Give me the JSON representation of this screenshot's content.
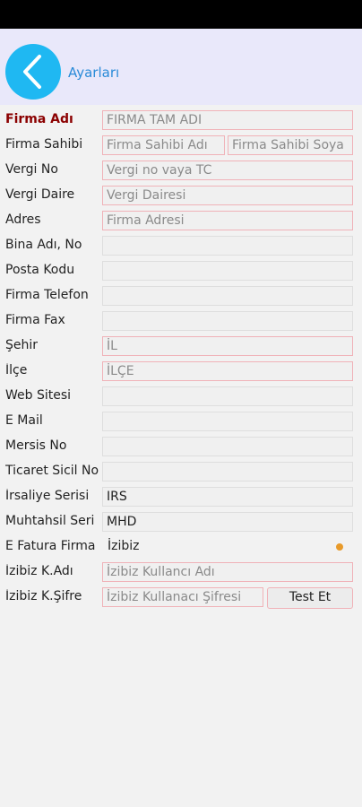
{
  "header": {
    "title": "Ayarları"
  },
  "rows": {
    "firma_adi": {
      "label": "Firma Adı",
      "placeholder": "FIRMA TAM ADI"
    },
    "firma_sahibi": {
      "label": "Firma Sahibi",
      "placeholder1": "Firma Sahibi Adı",
      "placeholder2": "Firma Sahibi Soya"
    },
    "vergi_no": {
      "label": "Vergi No",
      "placeholder": "Vergi no vaya TC"
    },
    "vergi_daire": {
      "label": "Vergi Daire",
      "placeholder": "Vergi Dairesi"
    },
    "adres": {
      "label": "Adres",
      "placeholder": "Firma Adresi"
    },
    "bina": {
      "label": "Bina Adı, No"
    },
    "posta": {
      "label": "Posta Kodu"
    },
    "telefon": {
      "label": "Firma Telefon"
    },
    "fax": {
      "label": "Firma Fax"
    },
    "sehir": {
      "label": "Şehir",
      "placeholder": "İL"
    },
    "ilce": {
      "label": "İlçe",
      "placeholder": "İLÇE"
    },
    "web": {
      "label": "Web Sitesi"
    },
    "email": {
      "label": "E Mail"
    },
    "mersis": {
      "label": "Mersis No"
    },
    "ticaret": {
      "label": "Ticaret Sicil No"
    },
    "irsaliye": {
      "label": "İrsaliye Serisi",
      "value": "IRS"
    },
    "muhtahsil": {
      "label": "Muhtahsil Seri",
      "value": "MHD"
    },
    "efatura": {
      "label": "E Fatura Firma",
      "value": "İzibiz"
    },
    "izibiz_kadi": {
      "label": "İzibiz K.Adı",
      "placeholder": "İzibiz Kullancı Adı"
    },
    "izibiz_sifre": {
      "label": "İzibiz K.Şifre",
      "placeholder": "İzibiz Kullanacı Şifresi",
      "button": "Test Et"
    }
  },
  "colors": {
    "accent": "#1fb8f2",
    "required_border": "#f0b2b8",
    "title": "#2a8bd8"
  }
}
